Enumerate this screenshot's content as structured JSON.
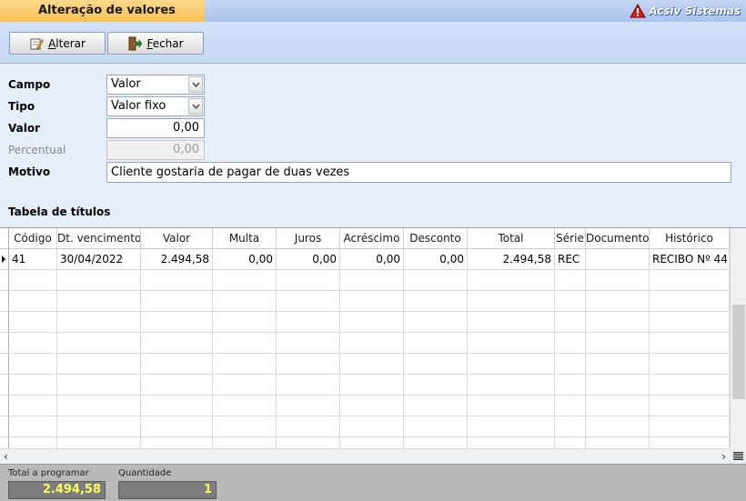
{
  "window": {
    "title": "Alteração de valores",
    "brand": "Acsiv Sistemas"
  },
  "toolbar": {
    "alterar_key": "A",
    "alterar_rest": "lterar",
    "fechar_key": "F",
    "fechar_rest": "echar"
  },
  "form": {
    "campo_label": "Campo",
    "campo_value": "Valor",
    "tipo_label": "Tipo",
    "tipo_value": "Valor fixo",
    "valor_label": "Valor",
    "valor_value": "0,00",
    "percentual_label": "Percentual",
    "percentual_value": "0,00",
    "motivo_label": "Motivo",
    "motivo_value": "Cliente gostaria de pagar de duas vezes"
  },
  "table": {
    "title": "Tabela de títulos",
    "columns": [
      "Código",
      "Dt. vencimento",
      "Valor",
      "Multa",
      "Juros",
      "Acréscimo",
      "Desconto",
      "Total",
      "Série",
      "Documento",
      "Histórico"
    ],
    "rows": [
      [
        "41",
        "30/04/2022",
        "2.494,58",
        "0,00",
        "0,00",
        "0,00",
        "0,00",
        "2.494,58",
        "REC",
        "",
        "RECIBO Nº 44"
      ]
    ]
  },
  "footer": {
    "total_label": "Total a programar",
    "total_value": "2.494,58",
    "quantidade_label": "Quantidade",
    "quantidade_value": "1"
  },
  "colors": {
    "title_tab": "#f7c255",
    "accent": "#c6d9f5",
    "footer_value": "#ffff5a"
  }
}
